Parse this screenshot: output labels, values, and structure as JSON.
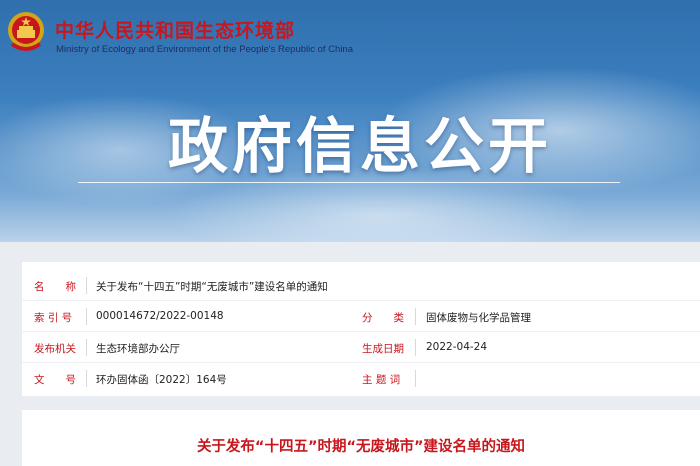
{
  "header": {
    "site_title": "中华人民共和国生态环境部",
    "site_subtitle": "Ministry of Ecology and Environment of the People's Republic of China",
    "hero_title": "政府信息公开",
    "emblem_icon": "national-emblem-icon"
  },
  "info": {
    "title_label": "名　　称",
    "title_value": "关于发布“十四五”时期“无废城市”建设名单的通知",
    "index_label": "索 引 号",
    "index_value": "000014672/2022-00148",
    "category_label": "分　　类",
    "category_value": "固体废物与化学品管理",
    "issuer_label": "发布机关",
    "issuer_value": "生态环境部办公厅",
    "date_label": "生成日期",
    "date_value": "2022-04-24",
    "docno_label": "文　　号",
    "docno_value": "环办固体函〔2022〕164号",
    "subject_label": "主 题 词",
    "subject_value": ""
  },
  "document": {
    "title": "关于发布“十四五”时期“无废城市”建设名单的通知"
  },
  "colors": {
    "accent_red": "#c8161d",
    "banner_blue": "#3d80bf"
  }
}
